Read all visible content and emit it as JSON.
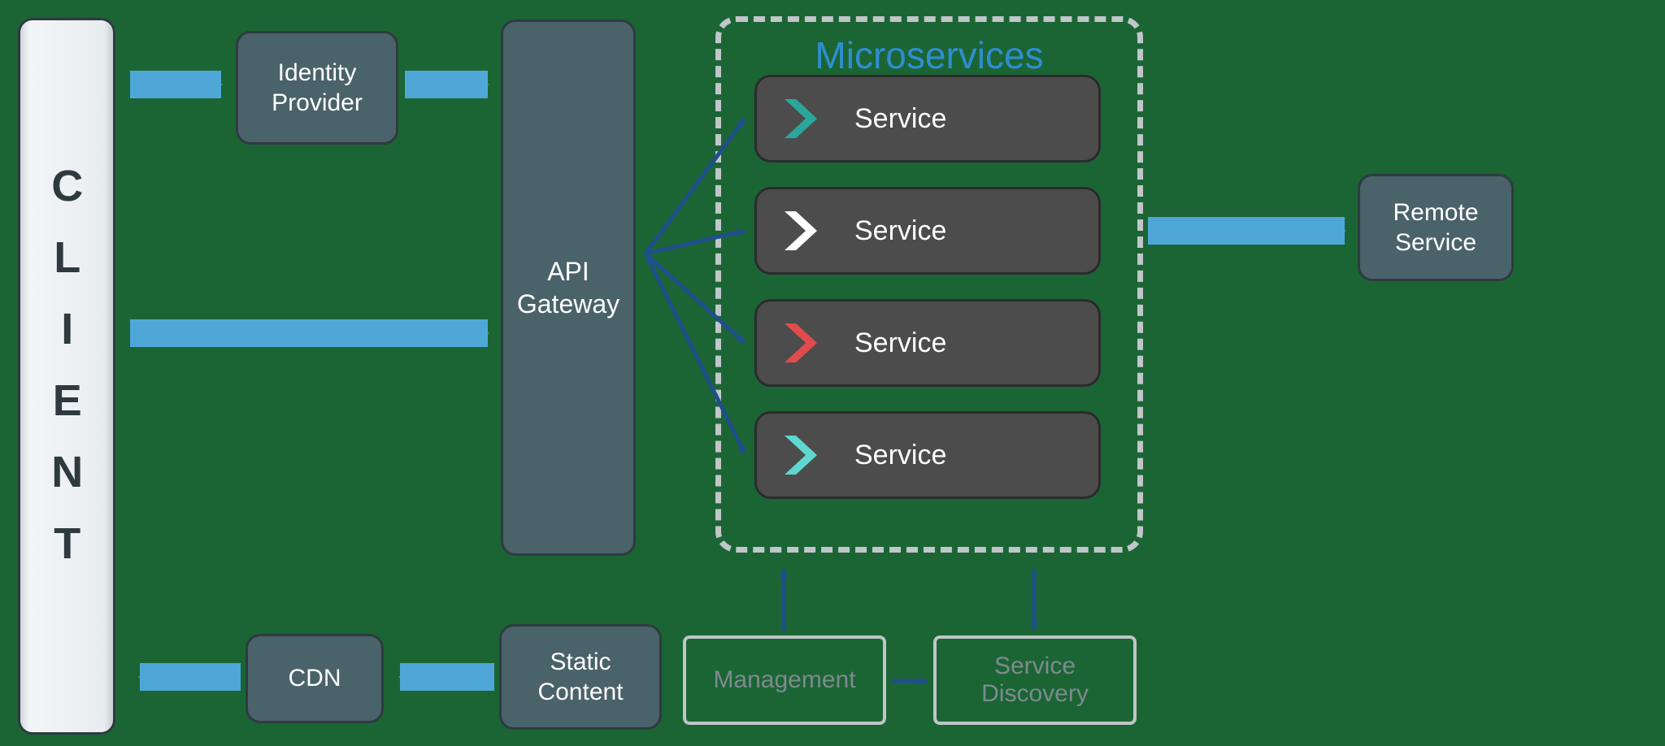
{
  "client": {
    "label": "CLIENT"
  },
  "identity_provider": {
    "label": "Identity\nProvider"
  },
  "api_gateway": {
    "label": "API\nGateway"
  },
  "cdn": {
    "label": "CDN"
  },
  "static_content": {
    "label": "Static\nContent"
  },
  "remote_service": {
    "label": "Remote\nService"
  },
  "microservices": {
    "title": "Microservices",
    "services": [
      {
        "label": "Service",
        "chevron_color": "#29a79a"
      },
      {
        "label": "Service",
        "chevron_color": "#ffffff"
      },
      {
        "label": "Service",
        "chevron_color": "#e14b4b"
      },
      {
        "label": "Service",
        "chevron_color": "#5fd6d0"
      }
    ]
  },
  "management": {
    "label": "Management"
  },
  "service_discovery": {
    "label": "Service\nDiscovery"
  },
  "colors": {
    "arrow_light": "#4fa7d8",
    "arrow_dark": "#1f4f8b",
    "box_fill": "#4a6269"
  }
}
